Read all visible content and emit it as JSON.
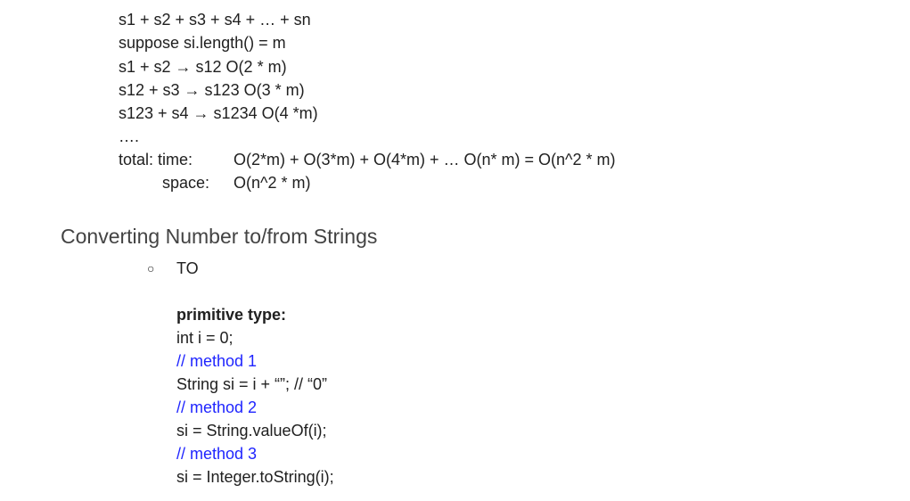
{
  "complexity": {
    "lines": [
      "s1 + s2 + s3 + s4 + … + sn",
      "suppose si.length() = m",
      "s1 + s2 → s12 O(2 * m)",
      "s12 + s3 → s123 O(3 * m)",
      "s123 + s4 → s1234 O(4 *m)",
      "…."
    ],
    "total_label": "total: time:",
    "total_time": "O(2*m) + O(3*m) + O(4*m) + … O(n* m) = O(n^2 * m)",
    "space_label": "space:",
    "space_value": "O(n^2 * m)"
  },
  "section": {
    "heading": "Converting Number to/from Strings",
    "bullet_symbol": "○",
    "bullet_label": "TO",
    "code": {
      "title": "primitive type:",
      "line1": "int i = 0;",
      "comment1": "// method 1",
      "line2": "String si = i + “”; // “0”",
      "comment2": "// method 2",
      "line3": "si = String.valueOf(i);",
      "comment3": "// method 3",
      "line4": "si = Integer.toString(i);"
    }
  },
  "colors": {
    "comment": "#1f25ff",
    "heading": "#434343",
    "text": "#202020"
  }
}
